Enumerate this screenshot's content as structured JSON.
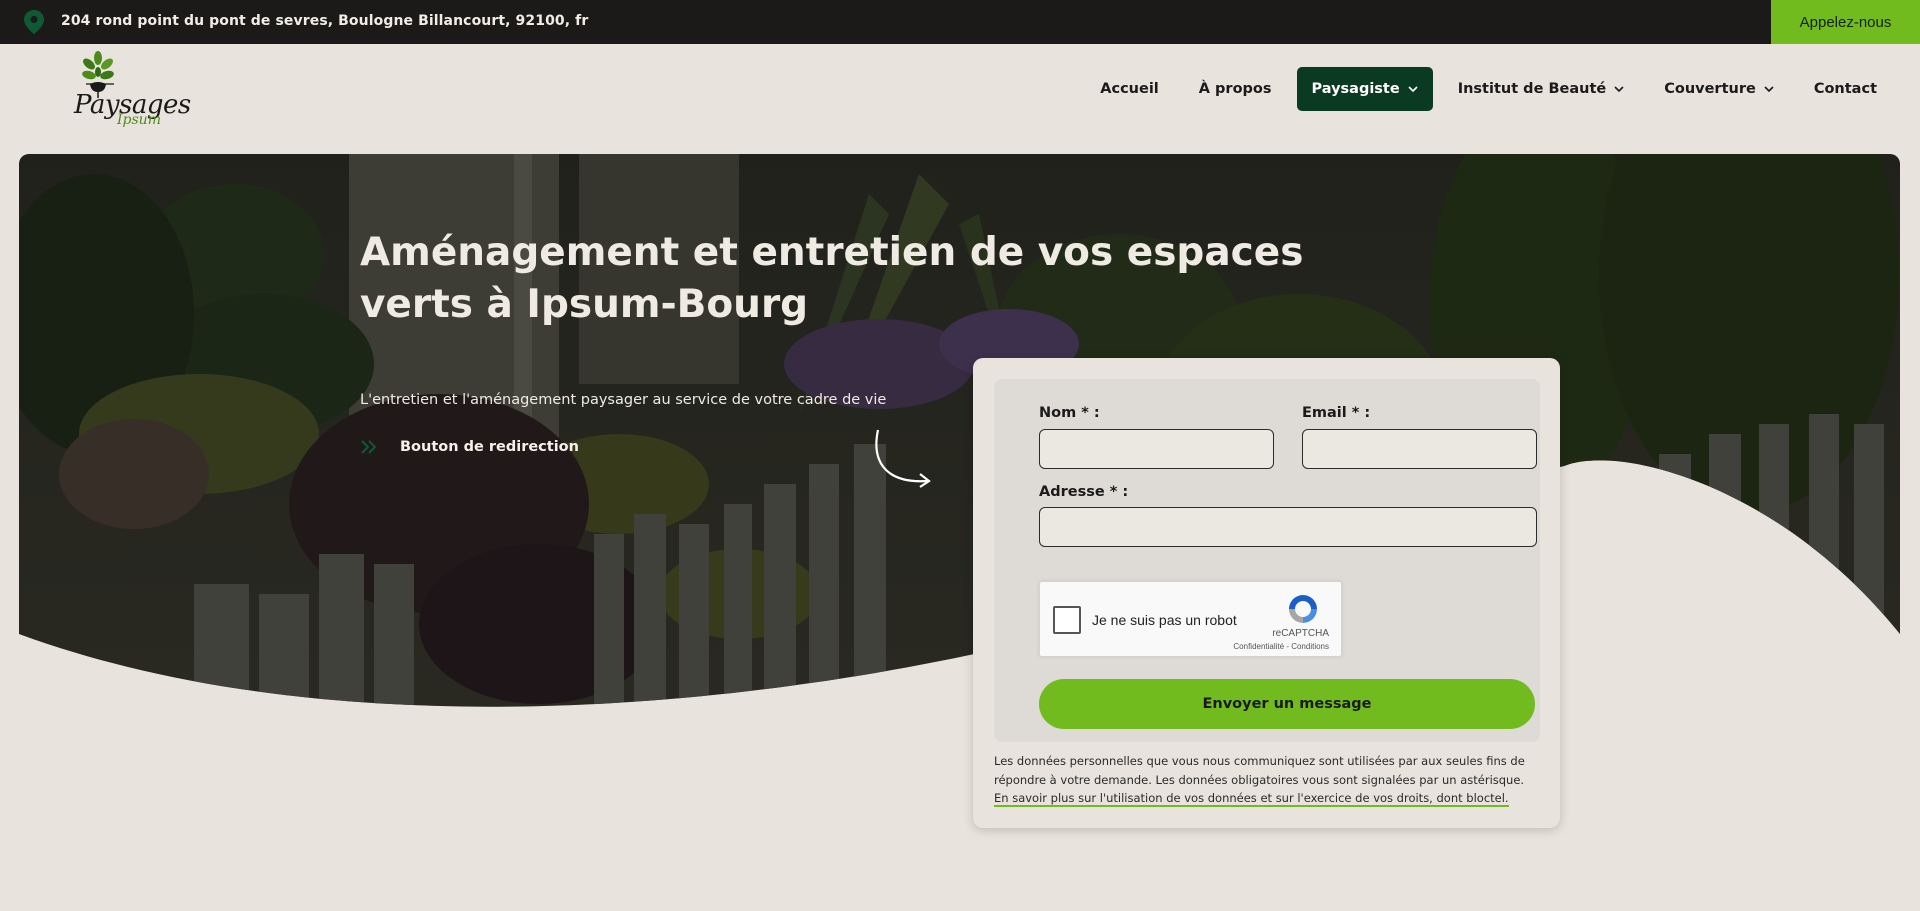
{
  "topbar": {
    "address": "204 rond point du pont de sevres, Boulogne Billancourt, 92100, fr",
    "call_label": "Appelez-nous",
    "pin_icon": "location-pin-icon"
  },
  "logo": {
    "line1": "Paysages",
    "line2": "Ipsum"
  },
  "nav": {
    "items": [
      {
        "label": "Accueil",
        "dropdown": false,
        "active": false
      },
      {
        "label": "À propos",
        "dropdown": false,
        "active": false
      },
      {
        "label": "Paysagiste",
        "dropdown": true,
        "active": true
      },
      {
        "label": "Institut de Beauté",
        "dropdown": true,
        "active": false
      },
      {
        "label": "Couverture",
        "dropdown": true,
        "active": false
      },
      {
        "label": "Contact",
        "dropdown": false,
        "active": false
      }
    ]
  },
  "hero": {
    "title": "Aménagement et entretien de vos espaces verts à Ipsum-Bourg",
    "subtitle": "L'entretien et l'aménagement paysager au service de votre cadre de vie",
    "redirect_label": "Bouton de redirection"
  },
  "form": {
    "name_label": "Nom * :",
    "name_value": "",
    "email_label": "Email * :",
    "email_value": "",
    "address_label": "Adresse * :",
    "address_value": "",
    "recaptcha_label": "Je ne suis pas un robot",
    "recaptcha_brand": "reCAPTCHA",
    "recaptcha_links": "Confidentialité - Conditions",
    "send_label": "Envoyer un message",
    "privacy_text": "Les données personnelles que vous nous communiquez sont utilisées par aux seules fins de répondre à votre demande. Les données obligatoires vous sont signalées par un astérisque. ",
    "privacy_link": "En savoir plus sur l'utilisation de vos données et sur l'exercice de vos droits, dont bloctel."
  },
  "colors": {
    "accent_green": "#72bb1f",
    "dark_green": "#0b3a22",
    "topbar_bg": "#1b1a18",
    "page_bg": "#e8e3dc"
  }
}
